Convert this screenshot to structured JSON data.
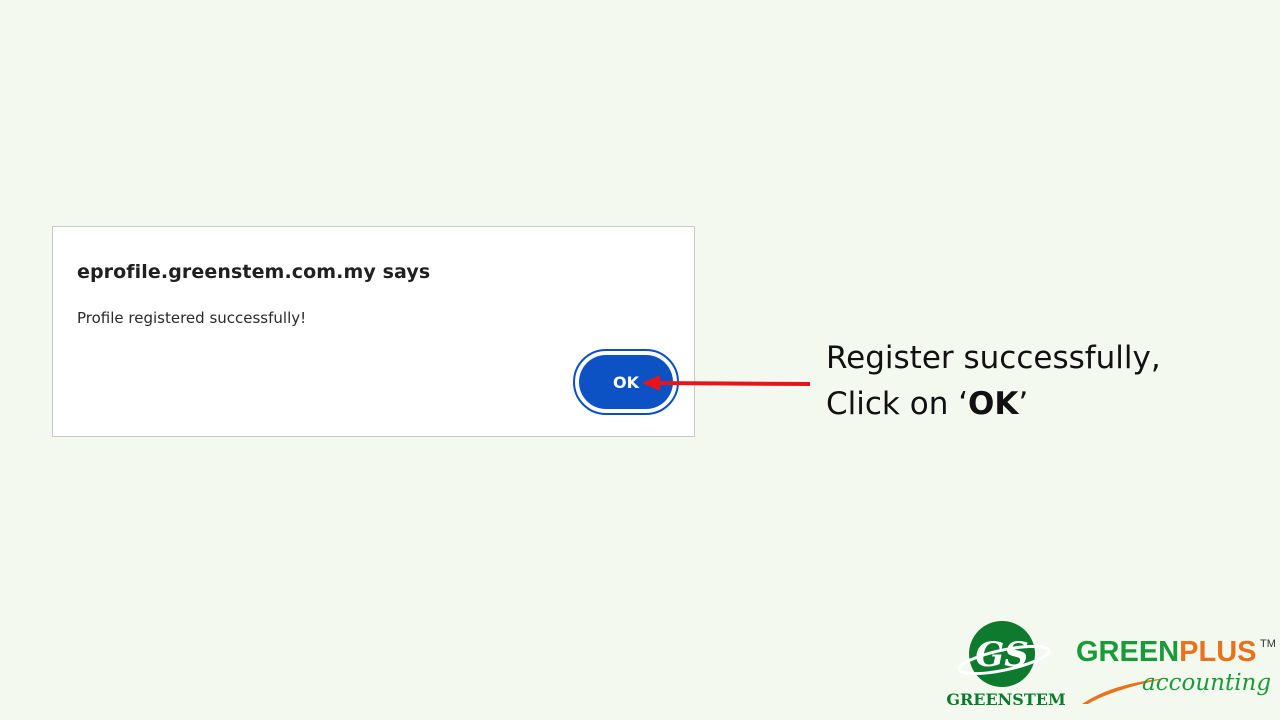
{
  "dialog": {
    "title": "eprofile.greenstem.com.my says",
    "message": "Profile registered successfully!",
    "ok_label": "OK"
  },
  "annotation": {
    "line1": "Register successfully,",
    "line2_prefix": "Click on ‘",
    "line2_bold": "OK",
    "line2_suffix": "’",
    "arrow_color": "#e8141b"
  },
  "logos": {
    "greenstem_monogram": "GS",
    "greenstem_name": "GREENSTEM",
    "greenplus_part1": "GREEN",
    "greenplus_part2": "PLUS",
    "greenplus_tm": "TM",
    "greenplus_sub": "accounting"
  },
  "colors": {
    "background": "#f3f9ef",
    "button_blue": "#0c52c4",
    "brand_green": "#1b9a3a",
    "brand_orange": "#e8731c"
  }
}
